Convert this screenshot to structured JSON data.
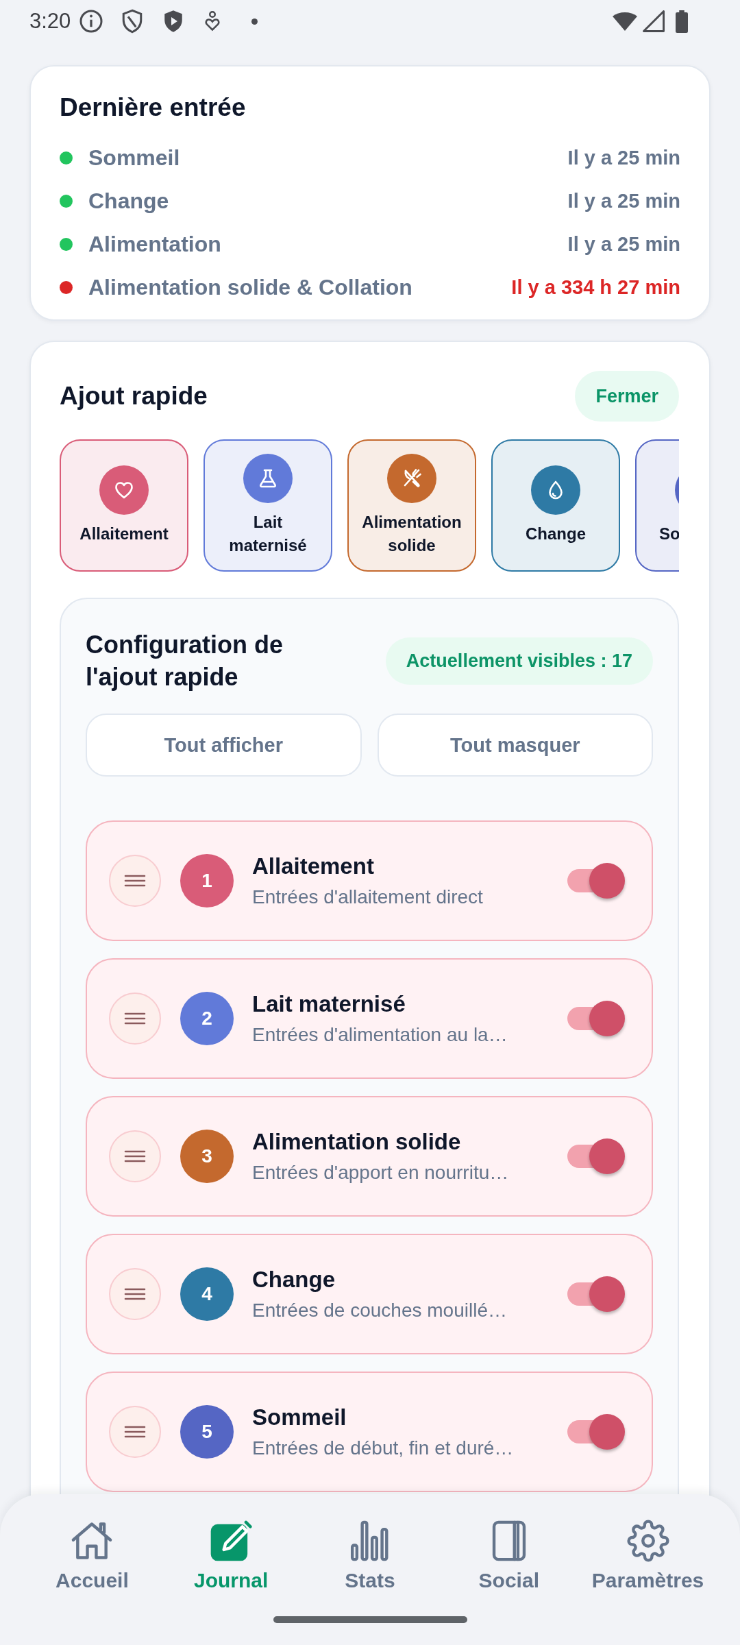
{
  "status_bar": {
    "time": "3:20"
  },
  "last_entry": {
    "title": "Dernière entrée",
    "items": [
      {
        "label": "Sommeil",
        "time": "Il y a 25 min",
        "color": "#22c55e",
        "overdue": false
      },
      {
        "label": "Change",
        "time": "Il y a 25 min",
        "color": "#22c55e",
        "overdue": false
      },
      {
        "label": "Alimentation",
        "time": "Il y a 25 min",
        "color": "#22c55e",
        "overdue": false
      },
      {
        "label": "Alimentation solide & Collation",
        "time": "Il y a 334 h 27 min",
        "color": "#dc2626",
        "overdue": true
      }
    ]
  },
  "quick_add": {
    "title": "Ajout rapide",
    "close_button": "Fermer",
    "tiles": [
      {
        "label": "Allaitement",
        "kind": "nursing",
        "color": "#d95c78"
      },
      {
        "label": "Lait maternisé",
        "kind": "formula",
        "color": "#617ad9"
      },
      {
        "label": "Alimentation solide",
        "kind": "solid",
        "color": "#c4692e"
      },
      {
        "label": "Change",
        "kind": "diaper",
        "color": "#2e7aa5"
      },
      {
        "label": "So",
        "kind": "sleep",
        "color": "#5566c4"
      }
    ],
    "config": {
      "title": "Configuration de l'ajout rapide",
      "visible_count": "Actuellement visibles : 17",
      "buttons": [
        "Tout afficher",
        "Tout masquer"
      ],
      "rows": [
        {
          "number": "1",
          "title": "Allaitement",
          "subtitle": "Entrées d'allaitement direct",
          "color": "#d95c78",
          "on": true
        },
        {
          "number": "2",
          "title": "Lait maternisé",
          "subtitle": "Entrées d'alimentation au la…",
          "color": "#617ad9",
          "on": true
        },
        {
          "number": "3",
          "title": "Alimentation solide",
          "subtitle": "Entrées d'apport en nourritu…",
          "color": "#c4692e",
          "on": true
        },
        {
          "number": "4",
          "title": "Change",
          "subtitle": "Entrées de couches mouillé…",
          "color": "#2e7aa5",
          "on": true
        },
        {
          "number": "5",
          "title": "Sommeil",
          "subtitle": "Entrées de début, fin et duré…",
          "color": "#5566c4",
          "on": true
        }
      ]
    }
  },
  "bottom_nav": [
    {
      "label": "Accueil",
      "kind": "home",
      "selected": false
    },
    {
      "label": "Journal",
      "kind": "journal",
      "selected": true
    },
    {
      "label": "Stats",
      "kind": "stats",
      "selected": false
    },
    {
      "label": "Social",
      "kind": "social",
      "selected": false
    },
    {
      "label": "Paramètres",
      "kind": "settings",
      "selected": false
    }
  ]
}
